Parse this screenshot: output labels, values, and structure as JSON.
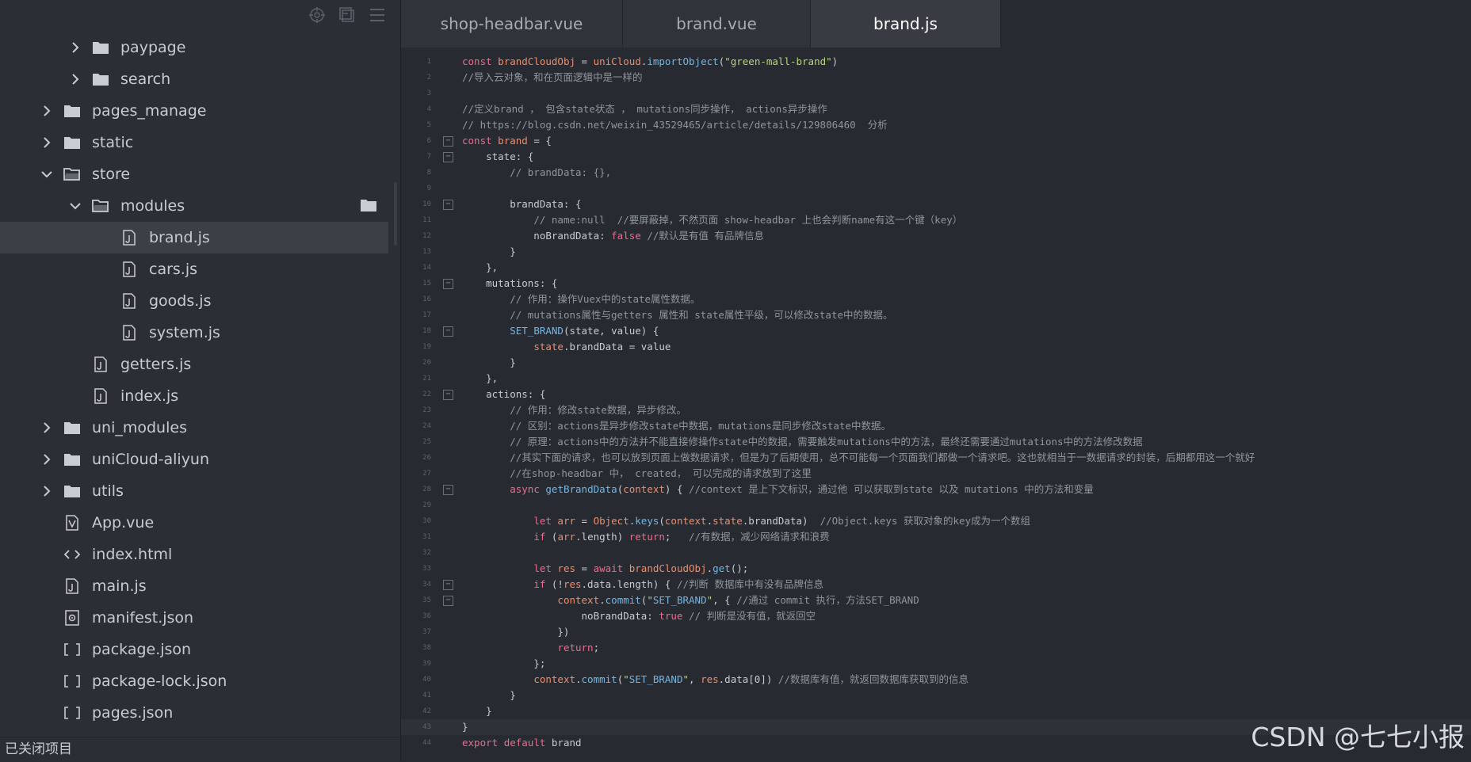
{
  "sidebar": {
    "toolbar_icons": [
      "target-icon",
      "collapse-all-icon",
      "menu-icon"
    ],
    "items": [
      {
        "label": "paypage",
        "type": "folder",
        "depth": 2,
        "expanded": false
      },
      {
        "label": "search",
        "type": "folder",
        "depth": 2,
        "expanded": false
      },
      {
        "label": "pages_manage",
        "type": "folder",
        "depth": 1,
        "expanded": false
      },
      {
        "label": "static",
        "type": "folder",
        "depth": 1,
        "expanded": false
      },
      {
        "label": "store",
        "type": "folder",
        "depth": 1,
        "expanded": true
      },
      {
        "label": "modules",
        "type": "folder",
        "depth": 2,
        "expanded": true
      },
      {
        "label": "brand.js",
        "type": "js",
        "depth": 3,
        "selected": true
      },
      {
        "label": "cars.js",
        "type": "js",
        "depth": 3
      },
      {
        "label": "goods.js",
        "type": "js",
        "depth": 3
      },
      {
        "label": "system.js",
        "type": "js",
        "depth": 3
      },
      {
        "label": "getters.js",
        "type": "js",
        "depth": 2
      },
      {
        "label": "index.js",
        "type": "js",
        "depth": 2
      },
      {
        "label": "uni_modules",
        "type": "folder",
        "depth": 1,
        "expanded": false
      },
      {
        "label": "uniCloud-aliyun",
        "type": "folder",
        "depth": 1,
        "expanded": false
      },
      {
        "label": "utils",
        "type": "folder",
        "depth": 1,
        "expanded": false
      },
      {
        "label": "App.vue",
        "type": "vue",
        "depth": 1
      },
      {
        "label": "index.html",
        "type": "html",
        "depth": 1
      },
      {
        "label": "main.js",
        "type": "js",
        "depth": 1
      },
      {
        "label": "manifest.json",
        "type": "manifest",
        "depth": 1
      },
      {
        "label": "package.json",
        "type": "json",
        "depth": 1
      },
      {
        "label": "package-lock.json",
        "type": "json",
        "depth": 1
      },
      {
        "label": "pages.json",
        "type": "json",
        "depth": 1
      }
    ],
    "bottom_label": "已关闭项目"
  },
  "tabs": [
    {
      "label": "shop-headbar.vue",
      "active": false
    },
    {
      "label": "brand.vue",
      "active": false
    },
    {
      "label": "brand.js",
      "active": true
    }
  ],
  "code_lines": [
    {
      "n": "1",
      "fold": false,
      "text": "const brandCloudObj = uniCloud.importObject(\"green-mall-brand\")"
    },
    {
      "n": "2",
      "fold": false,
      "text": "//导入云对象，和在页面逻辑中是一样的"
    },
    {
      "n": "3",
      "fold": false,
      "text": ""
    },
    {
      "n": "4",
      "fold": false,
      "text": "//定义brand ， 包含state状态 ， mutations同步操作， actions异步操作"
    },
    {
      "n": "5",
      "fold": false,
      "text": "// https://blog.csdn.net/weixin_43529465/article/details/129806460  分析"
    },
    {
      "n": "6",
      "fold": true,
      "text": "const brand = {"
    },
    {
      "n": "7",
      "fold": true,
      "text": "    state: {"
    },
    {
      "n": "8",
      "fold": false,
      "text": "        // brandData: {},"
    },
    {
      "n": "9",
      "fold": false,
      "text": ""
    },
    {
      "n": "10",
      "fold": true,
      "text": "        brandData: {"
    },
    {
      "n": "11",
      "fold": false,
      "text": "            // name:null  //要屏蔽掉，不然页面 show-headbar 上也会判断name有这一个键（key）"
    },
    {
      "n": "12",
      "fold": false,
      "text": "            noBrandData: false //默认是有值 有品牌信息"
    },
    {
      "n": "13",
      "fold": false,
      "text": "        }"
    },
    {
      "n": "14",
      "fold": false,
      "text": "    },"
    },
    {
      "n": "15",
      "fold": true,
      "text": "    mutations: {"
    },
    {
      "n": "16",
      "fold": false,
      "text": "        // 作用：操作Vuex中的state属性数据。"
    },
    {
      "n": "17",
      "fold": false,
      "text": "        // mutations属性与getters 属性和 state属性平级，可以修改state中的数据。"
    },
    {
      "n": "18",
      "fold": true,
      "text": "        SET_BRAND(state, value) {"
    },
    {
      "n": "19",
      "fold": false,
      "text": "            state.brandData = value"
    },
    {
      "n": "20",
      "fold": false,
      "text": "        }"
    },
    {
      "n": "21",
      "fold": false,
      "text": "    },"
    },
    {
      "n": "22",
      "fold": true,
      "text": "    actions: {"
    },
    {
      "n": "23",
      "fold": false,
      "text": "        // 作用：修改state数据，异步修改。"
    },
    {
      "n": "24",
      "fold": false,
      "text": "        // 区别：actions是异步修改state中数据，mutations是同步修改state中数据。"
    },
    {
      "n": "25",
      "fold": false,
      "text": "        // 原理：actions中的方法并不能直接修操作state中的数据，需要触发mutations中的方法，最终还需要通过mutations中的方法修改数据"
    },
    {
      "n": "26",
      "fold": false,
      "text": "        //其实下面的请求，也可以放到页面上做数据请求，但是为了后期使用，总不可能每一个页面我们都做一个请求吧。这也就相当于一数据请求的封装，后期都用这一个就好"
    },
    {
      "n": "27",
      "fold": false,
      "text": "        //在shop-headbar 中， created， 可以完成的请求放到了这里"
    },
    {
      "n": "28",
      "fold": true,
      "text": "        async getBrandData(context) { //context 是上下文标识，通过他 可以获取到state 以及 mutations 中的方法和变量"
    },
    {
      "n": "29",
      "fold": false,
      "text": ""
    },
    {
      "n": "30",
      "fold": false,
      "text": "            let arr = Object.keys(context.state.brandData)  //Object.keys 获取对象的key成为一个数组"
    },
    {
      "n": "31",
      "fold": false,
      "text": "            if (arr.length) return;   //有数据，减少网络请求和浪费"
    },
    {
      "n": "32",
      "fold": false,
      "text": ""
    },
    {
      "n": "33",
      "fold": false,
      "text": "            let res = await brandCloudObj.get();"
    },
    {
      "n": "34",
      "fold": true,
      "text": "            if (!res.data.length) { //判断 数据库中有没有品牌信息"
    },
    {
      "n": "35",
      "fold": true,
      "text": "                context.commit(\"SET_BRAND\", { //通过 commit 执行，方法SET_BRAND"
    },
    {
      "n": "36",
      "fold": false,
      "text": "                    noBrandData: true // 判断是没有值，就返回空"
    },
    {
      "n": "37",
      "fold": false,
      "text": "                })"
    },
    {
      "n": "38",
      "fold": false,
      "text": "                return;"
    },
    {
      "n": "39",
      "fold": false,
      "text": "            };"
    },
    {
      "n": "40",
      "fold": false,
      "text": "            context.commit(\"SET_BRAND\", res.data[0]) //数据库有值，就返回数据库获取到的信息"
    },
    {
      "n": "41",
      "fold": false,
      "text": "        }"
    },
    {
      "n": "42",
      "fold": false,
      "text": "    }"
    },
    {
      "n": "43",
      "fold": false,
      "text": "}"
    },
    {
      "n": "44",
      "fold": false,
      "text": "export default brand"
    }
  ],
  "watermark": "CSDN @七七小报"
}
